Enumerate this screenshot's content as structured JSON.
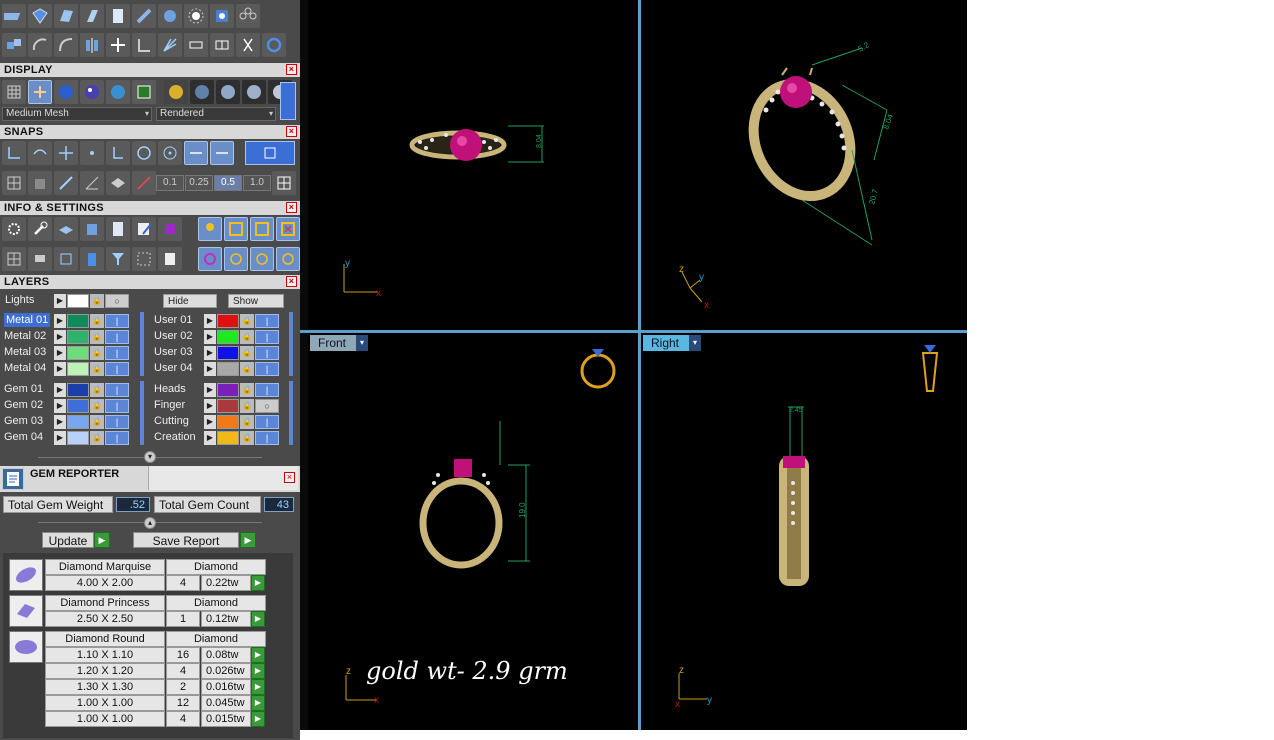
{
  "panel": {
    "sections": {
      "display": "DISPLAY",
      "snaps": "SNAPS",
      "info": "INFO & SETTINGS",
      "layers": "LAYERS"
    },
    "display": {
      "mesh_value": "Medium Mesh",
      "render_value": "Rendered"
    },
    "snaps": {
      "increments": [
        "0.1",
        "0.25",
        "0.5",
        "1.0"
      ],
      "selected": "0.5"
    },
    "layers": {
      "lights_label": "Lights",
      "hide_label": "Hide",
      "show_label": "Show",
      "left": [
        {
          "label": "Metal 01",
          "color": "#0f8a5a",
          "selected": true
        },
        {
          "label": "Metal 02",
          "color": "#2fb36a"
        },
        {
          "label": "Metal 03",
          "color": "#6fdc7a"
        },
        {
          "label": "Metal 04",
          "color": "#bdf3b5"
        },
        {
          "label": "Gem 01",
          "color": "#1a3fa8"
        },
        {
          "label": "Gem 02",
          "color": "#3d6fd6"
        },
        {
          "label": "Gem 03",
          "color": "#79a7ee"
        },
        {
          "label": "Gem 04",
          "color": "#b7d1f7"
        }
      ],
      "right": [
        {
          "label": "User 01",
          "color": "#e01010"
        },
        {
          "label": "User 02",
          "color": "#1ee81e"
        },
        {
          "label": "User 03",
          "color": "#1010e8"
        },
        {
          "label": "User 04",
          "color": "#a8a8a8"
        },
        {
          "label": "Heads",
          "color": "#7a1fb8"
        },
        {
          "label": "Finger",
          "color": "#a83a3a",
          "vis_off": true
        },
        {
          "label": "Cutting",
          "color": "#f07a1a"
        },
        {
          "label": "Creation",
          "color": "#f0b818"
        }
      ]
    },
    "gem_reporter": {
      "title": "GEM REPORTER",
      "total_weight_label": "Total Gem Weight",
      "total_weight_value": ".52",
      "total_count_label": "Total Gem Count",
      "total_count_value": "43",
      "update_label": "Update",
      "save_label": "Save Report",
      "groups": [
        {
          "shape": "marquise",
          "name": "Diamond Marquise",
          "material": "Diamond",
          "rows": [
            {
              "size": "4.00 X 2.00",
              "count": "4",
              "weight": "0.22tw"
            }
          ]
        },
        {
          "shape": "princess",
          "name": "Diamond Princess",
          "material": "Diamond",
          "rows": [
            {
              "size": "2.50 X 2.50",
              "count": "1",
              "weight": "0.12tw"
            }
          ]
        },
        {
          "shape": "round",
          "name": "Diamond Round",
          "material": "Diamond",
          "rows": [
            {
              "size": "1.10 X 1.10",
              "count": "16",
              "weight": "0.08tw"
            },
            {
              "size": "1.20 X 1.20",
              "count": "4",
              "weight": "0.026tw"
            },
            {
              "size": "1.30 X 1.30",
              "count": "2",
              "weight": "0.016tw"
            },
            {
              "size": "1.00 X 1.00",
              "count": "12",
              "weight": "0.045tw"
            },
            {
              "size": "1.00 X 1.00",
              "count": "4",
              "weight": "0.015tw"
            }
          ]
        }
      ]
    }
  },
  "viewports": {
    "front_label": "Front",
    "right_label": "Right",
    "overlay_text": "gold wt- 2.9 grm",
    "dims": {
      "top_height": "8.04",
      "persp_a": "8.04",
      "persp_b": "20.7",
      "persp_c": "5.2",
      "front_height": "19.0",
      "right_width": "2.45"
    },
    "axes": {
      "x": "x",
      "y": "y",
      "z": "z"
    }
  },
  "colors": {
    "grid_line": "#5aa0c8",
    "dim_line": "#1fa060",
    "gold": "#c9b47a",
    "ruby": "#c0107a",
    "axis_x": "#c01010",
    "axis_y": "#1aa0d8",
    "axis_z": "#c8a010"
  }
}
